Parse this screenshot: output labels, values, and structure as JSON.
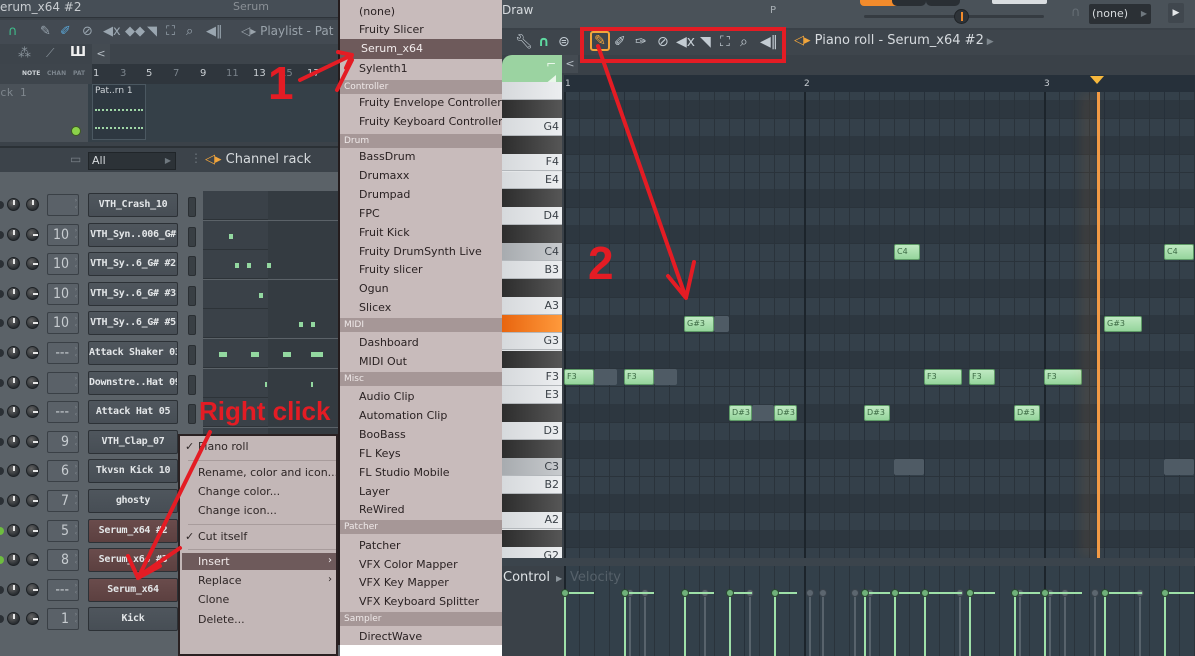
{
  "left_panel": {
    "window_title": "erum_x64 #2",
    "plugin_label": "Serum",
    "playlist": {
      "title": "Playlist - Pat",
      "toolbar_icons": [
        "headphones-icon",
        "pencil-icon",
        "paint-brush-icon",
        "delete-icon",
        "mute-icon",
        "slip-icon",
        "slice-icon",
        "select-icon",
        "zoom-icon",
        "playback-icon"
      ],
      "modes": [
        "NOTE",
        "CHAN",
        "PAT"
      ],
      "ruler": [
        "1",
        "3",
        "5",
        "7",
        "9",
        "11",
        "13",
        "15",
        "17"
      ],
      "track_label": "ck 1",
      "pattern_clip": "Pat..rn 1"
    },
    "channel_rack": {
      "filter": "All",
      "title": "Channel rack",
      "channels": [
        {
          "name": "VTH_Crash_10",
          "num": "",
          "serum": false,
          "steps": []
        },
        {
          "name": "VTH_Syn..006_G#",
          "num": "10",
          "serum": false,
          "steps": [
            26
          ]
        },
        {
          "name": "VTH_Sy..6_G# #2",
          "num": "10",
          "serum": false,
          "steps": [
            32,
            44,
            64
          ]
        },
        {
          "name": "VTH_Sy..6_G# #3",
          "num": "10",
          "serum": false,
          "steps": [
            56
          ]
        },
        {
          "name": "VTH_Sy..6_G# #5",
          "num": "10",
          "serum": false,
          "steps": [
            96,
            108
          ]
        },
        {
          "name": "Attack Shaker 03",
          "num": "---",
          "serum": false,
          "steps": [
            16,
            48,
            80,
            108
          ]
        },
        {
          "name": "Downstre..Hat 09",
          "num": "",
          "serum": false,
          "steps": [
            62,
            108
          ]
        },
        {
          "name": "Attack Hat 05",
          "num": "---",
          "serum": false,
          "steps": []
        },
        {
          "name": "VTH_Clap_07",
          "num": "9",
          "serum": false,
          "steps": []
        },
        {
          "name": "Tkvsn Kick 10",
          "num": "6",
          "serum": false,
          "steps": []
        },
        {
          "name": "ghosty",
          "num": "7",
          "serum": false,
          "steps": []
        },
        {
          "name": "Serum_x64 #2",
          "num": "5",
          "serum": true,
          "steps": []
        },
        {
          "name": "Serum_x64 #3",
          "num": "8",
          "serum": true,
          "steps": []
        },
        {
          "name": "Serum_x64",
          "num": "---",
          "serum": true,
          "steps": []
        },
        {
          "name": "Kick",
          "num": "1",
          "serum": false,
          "steps": []
        }
      ]
    },
    "context_menu": {
      "items": [
        {
          "label": "Piano roll",
          "checked": true
        },
        {
          "label": "Rename, color and icon..."
        },
        {
          "label": "Change color..."
        },
        {
          "label": "Change icon..."
        },
        {
          "label": "Cut itself",
          "checked": true
        },
        {
          "label": "Insert",
          "submenu": true,
          "highlighted": true
        },
        {
          "label": "Replace",
          "submenu": true
        },
        {
          "label": "Clone"
        },
        {
          "label": "Delete..."
        }
      ]
    }
  },
  "plugin_menu": {
    "entries": [
      {
        "type": "item",
        "label": "(none)"
      },
      {
        "type": "item",
        "label": "Fruity Slicer"
      },
      {
        "type": "item",
        "label": "Serum_x64",
        "highlighted": true
      },
      {
        "type": "item",
        "label": "Sylenth1"
      },
      {
        "type": "category",
        "label": "Controller"
      },
      {
        "type": "item",
        "label": "Fruity Envelope Controller"
      },
      {
        "type": "item",
        "label": "Fruity Keyboard Controller"
      },
      {
        "type": "category",
        "label": "Drum"
      },
      {
        "type": "item",
        "label": "BassDrum"
      },
      {
        "type": "item",
        "label": "Drumaxx"
      },
      {
        "type": "item",
        "label": "Drumpad"
      },
      {
        "type": "item",
        "label": "FPC"
      },
      {
        "type": "item",
        "label": "Fruit Kick"
      },
      {
        "type": "item",
        "label": "Fruity DrumSynth Live"
      },
      {
        "type": "item",
        "label": "Fruity slicer"
      },
      {
        "type": "item",
        "label": "Ogun"
      },
      {
        "type": "item",
        "label": "Slicex"
      },
      {
        "type": "category",
        "label": "MIDI"
      },
      {
        "type": "item",
        "label": "Dashboard"
      },
      {
        "type": "item",
        "label": "MIDI Out"
      },
      {
        "type": "category",
        "label": "Misc"
      },
      {
        "type": "item",
        "label": "Audio Clip"
      },
      {
        "type": "item",
        "label": "Automation Clip"
      },
      {
        "type": "item",
        "label": "BooBass"
      },
      {
        "type": "item",
        "label": "FL Keys"
      },
      {
        "type": "item",
        "label": "FL Studio Mobile"
      },
      {
        "type": "item",
        "label": "Layer"
      },
      {
        "type": "item",
        "label": "ReWired"
      },
      {
        "type": "category",
        "label": "Patcher"
      },
      {
        "type": "item",
        "label": "Patcher"
      },
      {
        "type": "item",
        "label": "VFX Color Mapper"
      },
      {
        "type": "item",
        "label": "VFX Key Mapper"
      },
      {
        "type": "item",
        "label": "VFX Keyboard Splitter"
      },
      {
        "type": "category",
        "label": "Sampler"
      },
      {
        "type": "item",
        "label": "DirectWave"
      }
    ]
  },
  "piano_roll": {
    "tool_label": "Draw",
    "p_label": "P",
    "snap_value": "(none)",
    "title": "Piano roll - Serum_x64 #2",
    "toolbar_icons": [
      "wrench-icon",
      "magnet-icon",
      "menu-icon",
      "pencil-draw-icon",
      "paint-icon",
      "paint-add-icon",
      "delete-icon",
      "mute-icon",
      "slice-icon",
      "select-icon",
      "zoom-icon",
      "playback-icon"
    ],
    "active_tool": "pencil-draw-icon",
    "ruler": [
      "1",
      "2",
      "3"
    ],
    "keys": [
      "G4",
      "F4",
      "E4",
      "D4",
      "C4",
      "B3",
      "A3",
      "G3",
      "F3",
      "E3",
      "D3",
      "C3",
      "B2",
      "A2",
      "G2"
    ],
    "notes": [
      {
        "pitch": "F3",
        "start": 0,
        "len": 2.0,
        "ghost_len": 1.5
      },
      {
        "pitch": "F3",
        "start": 4,
        "len": 2.0,
        "ghost_len": 1.5
      },
      {
        "pitch": "G#3",
        "start": 8,
        "len": 2.0,
        "ghost_len": 1.0
      },
      {
        "pitch": "D#3",
        "start": 11,
        "len": 1.5,
        "ghost_len": 1.5
      },
      {
        "pitch": "D#3",
        "start": 14,
        "len": 1.5,
        "ghost_len": 0
      },
      {
        "pitch": "D#3",
        "start": 20,
        "len": 1.75,
        "ghost_len": 0
      },
      {
        "pitch": "C4",
        "start": 22,
        "len": 1.75,
        "ghost_len": 0
      },
      {
        "pitch": "F3",
        "start": 24,
        "len": 2.5,
        "ghost_len": 0
      },
      {
        "pitch": "F3",
        "start": 27,
        "len": 1.75,
        "ghost_len": 0
      },
      {
        "pitch": "D#3",
        "start": 30,
        "len": 1.75,
        "ghost_len": 0
      },
      {
        "pitch": "F3",
        "start": 32,
        "len": 2.5,
        "ghost_len": 0
      },
      {
        "pitch": "G#3",
        "start": 36,
        "len": 2.5,
        "ghost_len": 0
      },
      {
        "pitch": "C4",
        "start": 40,
        "len": 2.0,
        "ghost_len": 0
      }
    ],
    "ghost_notes": [
      {
        "pitch": "C3",
        "start": 22,
        "len": 2.0
      },
      {
        "pitch": "C3",
        "start": 40,
        "len": 2.0
      }
    ],
    "playhead_step": 35.5,
    "control": {
      "label": "Control",
      "target": "Velocity"
    }
  },
  "annotations": {
    "step1": "1",
    "step2": "2",
    "right_click": "Right click"
  }
}
